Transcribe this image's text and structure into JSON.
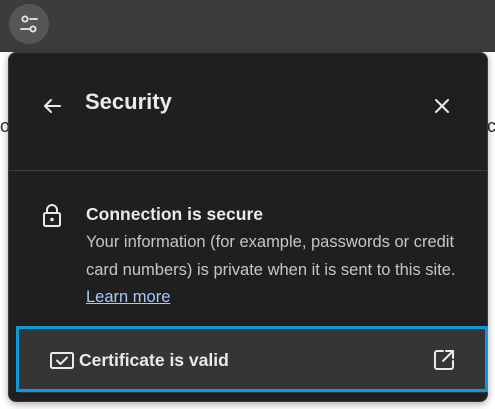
{
  "toolbar": {
    "site_info_icon": "tune-icon"
  },
  "background": {
    "left_glyph": "o",
    "right_glyph": "c"
  },
  "security_panel": {
    "title": "Security",
    "back_icon": "arrow-back-icon",
    "close_icon": "close-icon",
    "connection": {
      "icon": "lock-icon",
      "title": "Connection is secure",
      "description": "Your information (for example, passwords or credit card numbers) is private when it is sent to this site.",
      "learn_more": "Learn more"
    },
    "certificate": {
      "icon": "certificate-icon",
      "label": "Certificate is valid",
      "open_icon": "open-in-new-icon"
    }
  },
  "colors": {
    "panel_bg": "#1f1f1f",
    "link": "#a8c7fa",
    "focus_ring": "#0d98d9",
    "text_primary": "#e8eaed",
    "text_secondary": "#c4c7c5"
  }
}
